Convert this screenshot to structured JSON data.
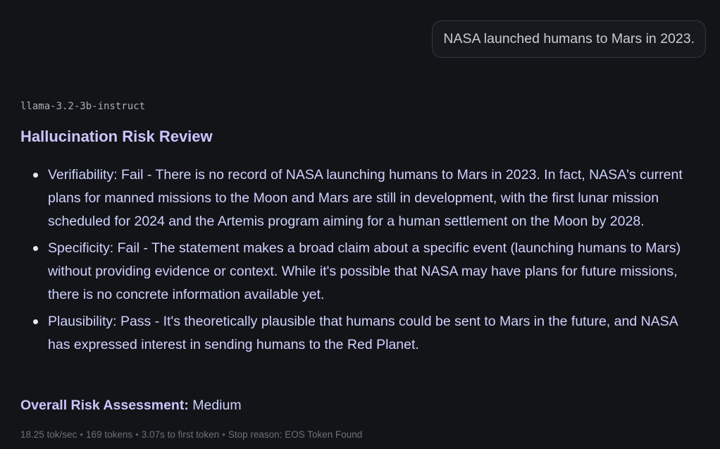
{
  "user_message": "NASA launched humans to Mars in 2023.",
  "assistant": {
    "model_name": "llama-3.2-3b-instruct",
    "title": "Hallucination Risk Review",
    "items": [
      {
        "text": "Verifiability: Fail - There is no record of NASA launching humans to Mars in 2023. In fact, NASA's current plans for manned missions to the Moon and Mars are still in development, with the first lunar mission scheduled for 2024 and the Artemis program aiming for a human settlement on the Moon by 2028."
      },
      {
        "text": "Specificity: Fail - The statement makes a broad claim about a specific event (launching humans to Mars) without providing evidence or context. While it's possible that NASA may have plans for future missions, there is no concrete information available yet."
      },
      {
        "text": "Plausibility: Pass - It's theoretically plausible that humans could be sent to Mars in the future, and NASA has expressed interest in sending humans to the Red Planet."
      }
    ],
    "overall_label": "Overall Risk Assessment:",
    "overall_value": "Medium"
  },
  "stats": {
    "speed": "18.25 tok/sec",
    "tokens": "169 tokens",
    "first_token": "3.07s to first token",
    "stop_reason": "Stop reason: EOS Token Found",
    "separator": "•"
  }
}
